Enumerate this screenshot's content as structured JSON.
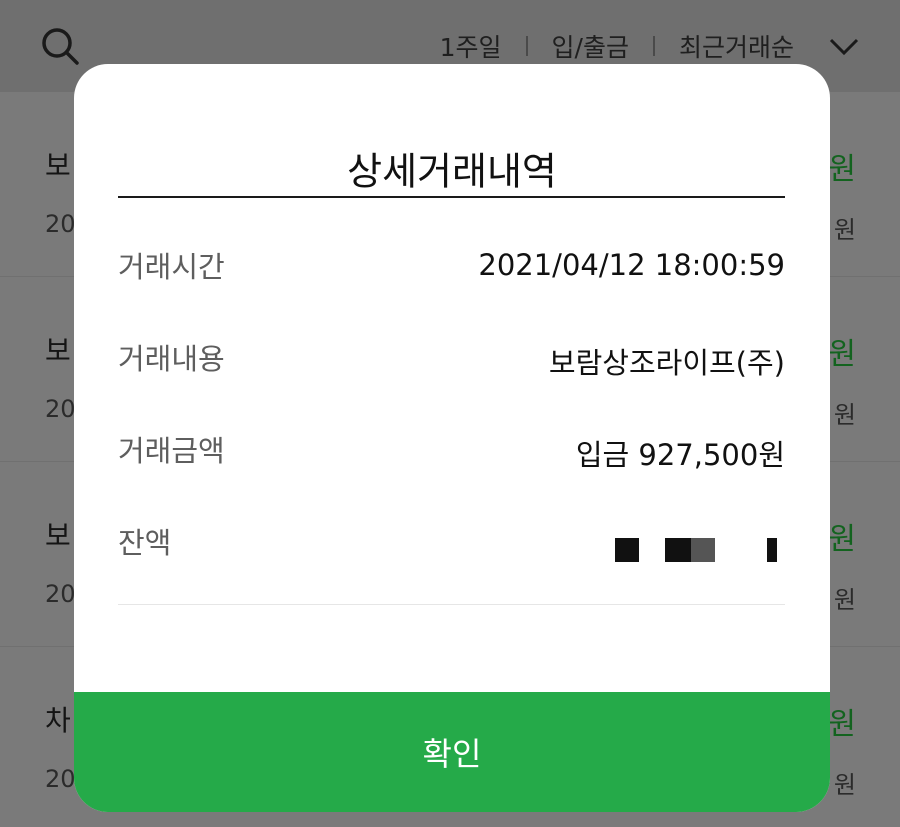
{
  "background": {
    "filters": {
      "period": "1주일",
      "type": "입/출금",
      "order": "최근거래순"
    },
    "rows": [
      {
        "name": "보",
        "date": "20",
        "amount": "원",
        "balance": "원"
      },
      {
        "name": "보",
        "date": "20",
        "amount": "원",
        "balance": "원"
      },
      {
        "name": "보",
        "date": "20",
        "amount": "원",
        "balance": "원"
      },
      {
        "name": "차",
        "date": "20",
        "amount": "원",
        "balance": "원"
      }
    ]
  },
  "modal": {
    "title": "상세거래내역",
    "rows": [
      {
        "label": "거래시간",
        "value": "2021/04/12 18:00:59"
      },
      {
        "label": "거래내용",
        "value": "보람상조라이프(주)"
      },
      {
        "label": "거래금액",
        "value": "입금 927,500원"
      },
      {
        "label": "잔액",
        "value": ""
      }
    ],
    "confirm_label": "확인"
  },
  "colors": {
    "accent": "#25aa49",
    "amount_green": "#13631f",
    "overlay": "#7a7a7a"
  },
  "icons": {
    "search": "search-icon",
    "dropdown": "chevron-down-icon"
  }
}
